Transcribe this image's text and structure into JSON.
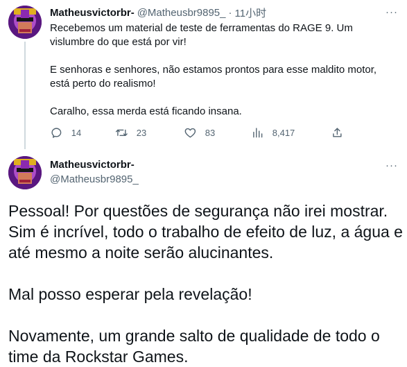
{
  "tweet1": {
    "display_name": "Matheusvictorbr-",
    "handle": "@Matheusbr9895_",
    "separator": "·",
    "time": "11小时",
    "more": "···",
    "text": "Recebemos um material de teste de ferramentas do RAGE 9. Um vislumbre do que está por vir!\n\nE senhoras e senhores, não estamos prontos para esse maldito motor, está perto do realismo!\n\nCaralho, essa merda está ficando insana.",
    "actions": {
      "reply_count": "14",
      "retweet_count": "23",
      "like_count": "83",
      "views_count": "8,417"
    }
  },
  "tweet2": {
    "display_name": "Matheusvictorbr-",
    "handle": "@Matheusbr9895_",
    "more": "···",
    "text": "Pessoal! Por questões de segurança não irei mostrar. Sim é incrível, todo o trabalho de efeito de luz, a água e até mesmo a noite serão alucinantes.\n\nMal posso esperar pela revelação!\n\nNovamente, um grande salto de qualidade de todo o time da Rockstar Games."
  },
  "icons": [
    "avatar",
    "reply-icon",
    "retweet-icon",
    "like-icon",
    "views-icon",
    "share-icon",
    "more-icon"
  ],
  "colors": {
    "text": "#0f1419",
    "secondary": "#536471",
    "thread_line": "#cfd9de",
    "avatar_bg": "#6a1e9a"
  }
}
